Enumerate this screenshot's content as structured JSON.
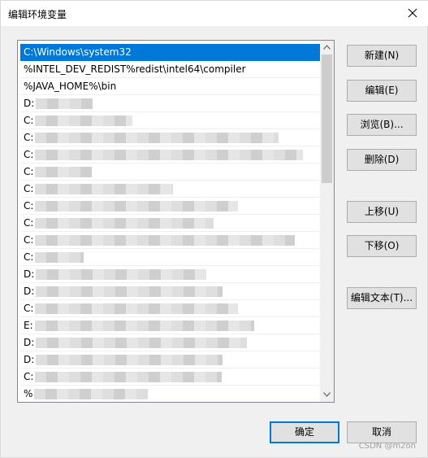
{
  "window": {
    "title": "编辑环境变量"
  },
  "list": {
    "items": [
      {
        "text": "C:\\Windows\\system32",
        "selected": true,
        "blur": 0
      },
      {
        "text": "%INTEL_DEV_REDIST%redist\\intel64\\compiler",
        "selected": false,
        "blur": 0
      },
      {
        "text": "%JAVA_HOME%\\bin",
        "selected": false,
        "blur": 0
      },
      {
        "text": "D:",
        "selected": false,
        "blur": 70
      },
      {
        "text": "C:",
        "selected": false,
        "blur": 120
      },
      {
        "text": "C:",
        "selected": false,
        "blur": 300
      },
      {
        "text": "C:",
        "selected": false,
        "blur": 330
      },
      {
        "text": "C:",
        "selected": false,
        "blur": 70
      },
      {
        "text": "C:",
        "selected": false,
        "blur": 170
      },
      {
        "text": "C:",
        "selected": false,
        "blur": 250
      },
      {
        "text": "C:",
        "selected": false,
        "blur": 220
      },
      {
        "text": "C:",
        "selected": false,
        "blur": 320
      },
      {
        "text": "C:",
        "selected": false,
        "blur": 60
      },
      {
        "text": "D:",
        "selected": false,
        "blur": 210
      },
      {
        "text": "D:",
        "selected": false,
        "blur": 230
      },
      {
        "text": "C:",
        "selected": false,
        "blur": 250
      },
      {
        "text": "E:",
        "selected": false,
        "blur": 270
      },
      {
        "text": "D:",
        "selected": false,
        "blur": 260
      },
      {
        "text": "D:",
        "selected": false,
        "blur": 230
      },
      {
        "text": "C:",
        "selected": false,
        "blur": 230
      },
      {
        "text": "%",
        "selected": false,
        "blur": 140
      }
    ]
  },
  "buttons": {
    "new": "新建(N)",
    "edit": "编辑(E)",
    "browse": "浏览(B)...",
    "delete": "删除(D)",
    "move_up": "上移(U)",
    "move_down": "下移(O)",
    "edit_text": "编辑文本(T)...",
    "ok": "确定",
    "cancel": "取消"
  },
  "watermark": "CSDN @m2on",
  "icons": {
    "close": "close-icon",
    "scroll_up": "chevron-up-icon",
    "scroll_down": "chevron-down-icon"
  },
  "colors": {
    "selection": "#0078d7",
    "button_face": "#e1e1e1"
  }
}
